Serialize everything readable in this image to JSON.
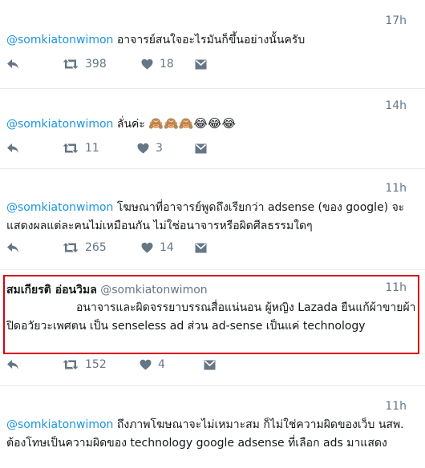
{
  "tweets": [
    {
      "time": "17h",
      "handle": "@somkiatonwimon",
      "text": "อาจารย์สนใจอะไรมันก็ขึ้นอย่างนั้นครับ",
      "retweets": "398",
      "likes": "18"
    },
    {
      "time": "14h",
      "handle": "@somkiatonwimon",
      "text": "ลั่นค่ะ",
      "emoji": "🙈🙈🙈😂😂😂",
      "retweets": "11",
      "likes": "3"
    },
    {
      "time": "11h",
      "handle": "@somkiatonwimon",
      "text": "โฆษณาที่อาจารย์พูดถึงเรียกว่า adsense (ของ google) จะแสดงผลแต่ละคนไม่เหมือนกัน ไม่ใช่อนาจารหรือผิดศีลธรรมใดๆ",
      "retweets": "265",
      "likes": "14"
    },
    {
      "time": "11h",
      "name": "สมเกียรติ อ่อนวิมล",
      "handle": "@somkiatonwimon",
      "text": "อนาจารและผิดจรรยาบรรณสื่อแน่นอน ผู้หญิง Lazada ยืนแก้ผ้าขายผ้าปิดอวัยวะเพศตน เป็น senseless ad ส่วน ad-sense เป็นแค่ technology",
      "retweets": "152",
      "likes": "4"
    },
    {
      "time": "11h",
      "handle": "@somkiatonwimon",
      "text": "ถึงภาพโฆษณาจะไม่เหมาะสม ก็ไม่ใช่ความผิดของเว็บ นสพ. ต้องโทษเป็นความผิดของ technology google adsense ที่เลือก ads มาแสดง"
    }
  ],
  "colors": {
    "link": "#1b95e0",
    "muted": "#657786",
    "highlight": "#d8000c",
    "separator": "#e6ecf0"
  }
}
